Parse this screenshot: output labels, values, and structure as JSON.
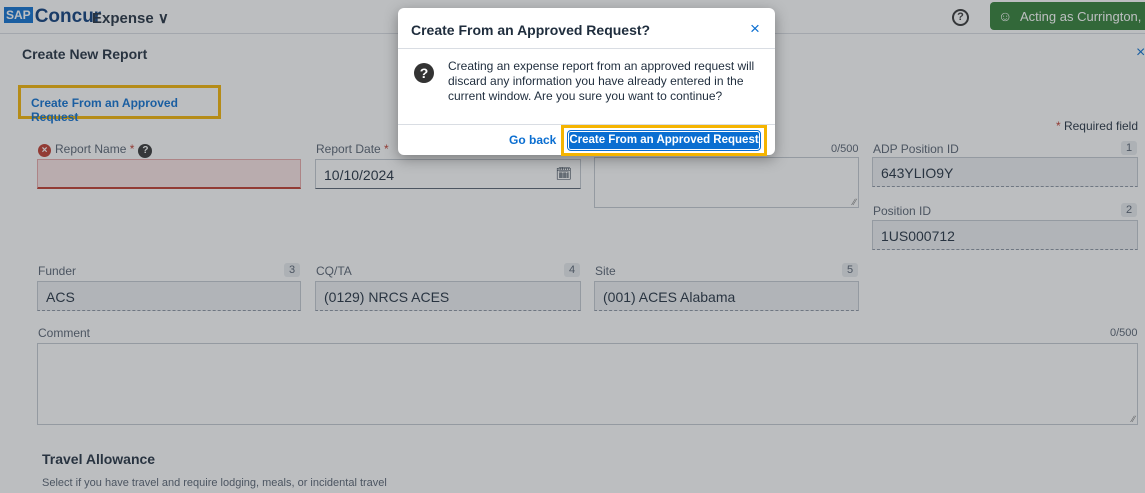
{
  "topbar": {
    "logo_sap": "SAP",
    "logo_text": "Concur",
    "app_menu": "Expense ∨",
    "help": "?",
    "acting": "Acting as Currington, Je"
  },
  "report": {
    "title": "Create New Report",
    "close": "×",
    "create_link": "Create From an Approved Request",
    "required_note": "Required field",
    "required_star": "*"
  },
  "fields": {
    "report_name": {
      "label": "Report Name",
      "value": ""
    },
    "report_date": {
      "label": "Report Date",
      "value": "10/10/2024"
    },
    "purpose_count": "0/500",
    "adp_position": {
      "label": "ADP Position ID",
      "num": "1",
      "value": "643YLIO9Y"
    },
    "position": {
      "label": "Position ID",
      "num": "2",
      "value": "1US000712"
    },
    "funder": {
      "label": "Funder",
      "num": "3",
      "value": "ACS"
    },
    "cqta": {
      "label": "CQ/TA",
      "num": "4",
      "value": "(0129) NRCS ACES"
    },
    "site": {
      "label": "Site",
      "num": "5",
      "value": "(001) ACES Alabama"
    },
    "comment": {
      "label": "Comment",
      "count": "0/500"
    }
  },
  "travel": {
    "title": "Travel Allowance",
    "desc": "Select if you have travel and require lodging, meals, or incidental travel"
  },
  "modal": {
    "title": "Create From an Approved Request?",
    "close": "×",
    "icon": "?",
    "body": "Creating an expense report from an approved request will discard any information you have already entered in the current window. Are you sure you want to continue?",
    "go_back": "Go back",
    "confirm": "Create From an Approved Request"
  },
  "colors": {
    "accent": "#0a6ed1",
    "highlight": "#f5b400",
    "error": "#c0392b",
    "acting_bg": "#2e7d32"
  }
}
